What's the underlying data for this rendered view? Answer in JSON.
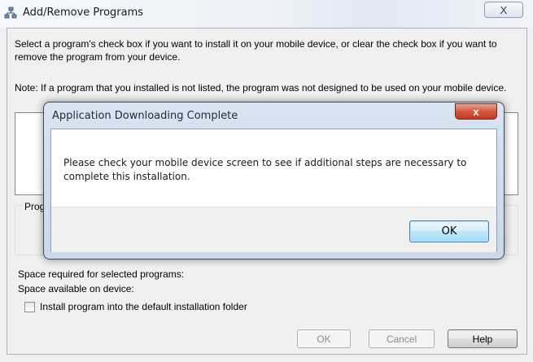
{
  "window": {
    "title": "Add/Remove Programs",
    "close_label": "X",
    "instructions": "Select a program's check box if you want to install it on your mobile device, or clear the check box if you want to remove the program from your device.",
    "note": "Note:  If a program that you installed is not listed, the program was not designed to be used on your mobile device.",
    "group_label": "Prog",
    "space_required": "Space required for selected programs:",
    "space_available": "Space available on device:",
    "install_default_label": "Install program into the default installation folder",
    "buttons": {
      "ok": "OK",
      "cancel": "Cancel",
      "help": "Help"
    }
  },
  "dialog": {
    "title": "Application Downloading Complete",
    "close_label": "x",
    "message": "Please check your mobile device screen to see if additional steps are necessary to complete this installation.",
    "ok_label": "OK"
  }
}
